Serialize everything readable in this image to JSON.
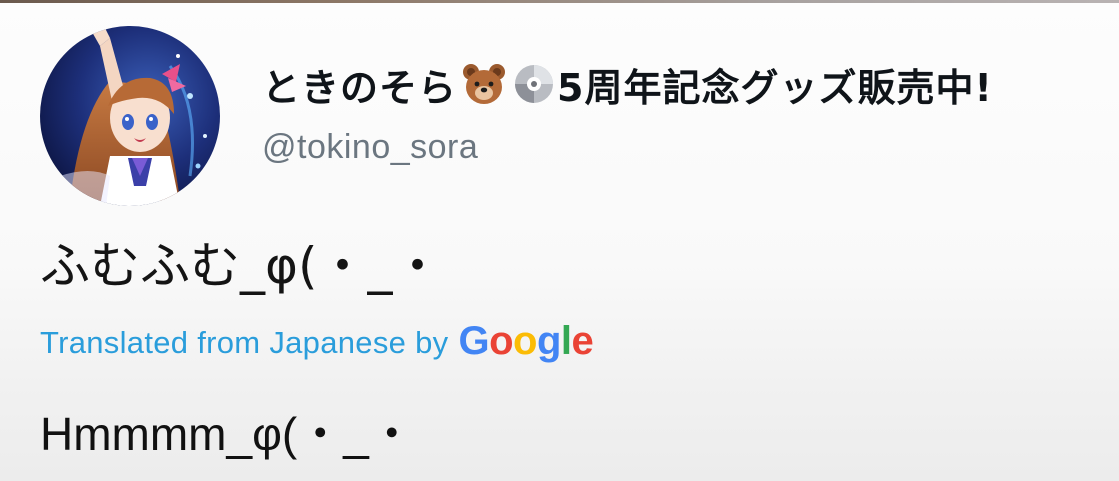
{
  "profile": {
    "display_name": "ときのそら",
    "display_name_suffix": "5周年記念グッズ販売中!",
    "name_emojis": [
      "bear-face-icon",
      "optical-disc-icon"
    ],
    "handle": "@tokino_sora",
    "avatar": "profile-avatar"
  },
  "tweet": {
    "text": "ふむふむ_φ(・_・"
  },
  "translation": {
    "label": "Translated from Japanese by",
    "provider": "Google",
    "text": "Hmmmm_φ(・_・"
  },
  "colors": {
    "translate_label": "#2a9ddb",
    "handle": "#6b7680",
    "google_blue": "#4285f4",
    "google_red": "#ea4335",
    "google_yellow": "#fbbc05",
    "google_green": "#34a853"
  }
}
